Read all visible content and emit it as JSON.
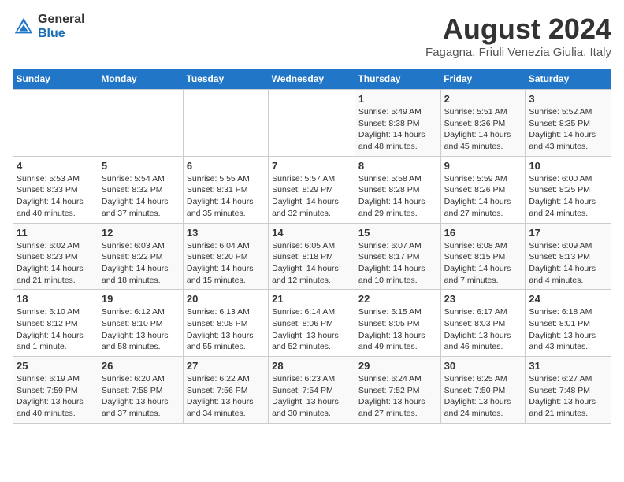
{
  "logo": {
    "general": "General",
    "blue": "Blue"
  },
  "title": {
    "month_year": "August 2024",
    "location": "Fagagna, Friuli Venezia Giulia, Italy"
  },
  "days_of_week": [
    "Sunday",
    "Monday",
    "Tuesday",
    "Wednesday",
    "Thursday",
    "Friday",
    "Saturday"
  ],
  "weeks": [
    [
      {
        "day": "",
        "info": ""
      },
      {
        "day": "",
        "info": ""
      },
      {
        "day": "",
        "info": ""
      },
      {
        "day": "",
        "info": ""
      },
      {
        "day": "1",
        "info": "Sunrise: 5:49 AM\nSunset: 8:38 PM\nDaylight: 14 hours and 48 minutes."
      },
      {
        "day": "2",
        "info": "Sunrise: 5:51 AM\nSunset: 8:36 PM\nDaylight: 14 hours and 45 minutes."
      },
      {
        "day": "3",
        "info": "Sunrise: 5:52 AM\nSunset: 8:35 PM\nDaylight: 14 hours and 43 minutes."
      }
    ],
    [
      {
        "day": "4",
        "info": "Sunrise: 5:53 AM\nSunset: 8:33 PM\nDaylight: 14 hours and 40 minutes."
      },
      {
        "day": "5",
        "info": "Sunrise: 5:54 AM\nSunset: 8:32 PM\nDaylight: 14 hours and 37 minutes."
      },
      {
        "day": "6",
        "info": "Sunrise: 5:55 AM\nSunset: 8:31 PM\nDaylight: 14 hours and 35 minutes."
      },
      {
        "day": "7",
        "info": "Sunrise: 5:57 AM\nSunset: 8:29 PM\nDaylight: 14 hours and 32 minutes."
      },
      {
        "day": "8",
        "info": "Sunrise: 5:58 AM\nSunset: 8:28 PM\nDaylight: 14 hours and 29 minutes."
      },
      {
        "day": "9",
        "info": "Sunrise: 5:59 AM\nSunset: 8:26 PM\nDaylight: 14 hours and 27 minutes."
      },
      {
        "day": "10",
        "info": "Sunrise: 6:00 AM\nSunset: 8:25 PM\nDaylight: 14 hours and 24 minutes."
      }
    ],
    [
      {
        "day": "11",
        "info": "Sunrise: 6:02 AM\nSunset: 8:23 PM\nDaylight: 14 hours and 21 minutes."
      },
      {
        "day": "12",
        "info": "Sunrise: 6:03 AM\nSunset: 8:22 PM\nDaylight: 14 hours and 18 minutes."
      },
      {
        "day": "13",
        "info": "Sunrise: 6:04 AM\nSunset: 8:20 PM\nDaylight: 14 hours and 15 minutes."
      },
      {
        "day": "14",
        "info": "Sunrise: 6:05 AM\nSunset: 8:18 PM\nDaylight: 14 hours and 12 minutes."
      },
      {
        "day": "15",
        "info": "Sunrise: 6:07 AM\nSunset: 8:17 PM\nDaylight: 14 hours and 10 minutes."
      },
      {
        "day": "16",
        "info": "Sunrise: 6:08 AM\nSunset: 8:15 PM\nDaylight: 14 hours and 7 minutes."
      },
      {
        "day": "17",
        "info": "Sunrise: 6:09 AM\nSunset: 8:13 PM\nDaylight: 14 hours and 4 minutes."
      }
    ],
    [
      {
        "day": "18",
        "info": "Sunrise: 6:10 AM\nSunset: 8:12 PM\nDaylight: 14 hours and 1 minute."
      },
      {
        "day": "19",
        "info": "Sunrise: 6:12 AM\nSunset: 8:10 PM\nDaylight: 13 hours and 58 minutes."
      },
      {
        "day": "20",
        "info": "Sunrise: 6:13 AM\nSunset: 8:08 PM\nDaylight: 13 hours and 55 minutes."
      },
      {
        "day": "21",
        "info": "Sunrise: 6:14 AM\nSunset: 8:06 PM\nDaylight: 13 hours and 52 minutes."
      },
      {
        "day": "22",
        "info": "Sunrise: 6:15 AM\nSunset: 8:05 PM\nDaylight: 13 hours and 49 minutes."
      },
      {
        "day": "23",
        "info": "Sunrise: 6:17 AM\nSunset: 8:03 PM\nDaylight: 13 hours and 46 minutes."
      },
      {
        "day": "24",
        "info": "Sunrise: 6:18 AM\nSunset: 8:01 PM\nDaylight: 13 hours and 43 minutes."
      }
    ],
    [
      {
        "day": "25",
        "info": "Sunrise: 6:19 AM\nSunset: 7:59 PM\nDaylight: 13 hours and 40 minutes."
      },
      {
        "day": "26",
        "info": "Sunrise: 6:20 AM\nSunset: 7:58 PM\nDaylight: 13 hours and 37 minutes."
      },
      {
        "day": "27",
        "info": "Sunrise: 6:22 AM\nSunset: 7:56 PM\nDaylight: 13 hours and 34 minutes."
      },
      {
        "day": "28",
        "info": "Sunrise: 6:23 AM\nSunset: 7:54 PM\nDaylight: 13 hours and 30 minutes."
      },
      {
        "day": "29",
        "info": "Sunrise: 6:24 AM\nSunset: 7:52 PM\nDaylight: 13 hours and 27 minutes."
      },
      {
        "day": "30",
        "info": "Sunrise: 6:25 AM\nSunset: 7:50 PM\nDaylight: 13 hours and 24 minutes."
      },
      {
        "day": "31",
        "info": "Sunrise: 6:27 AM\nSunset: 7:48 PM\nDaylight: 13 hours and 21 minutes."
      }
    ]
  ]
}
